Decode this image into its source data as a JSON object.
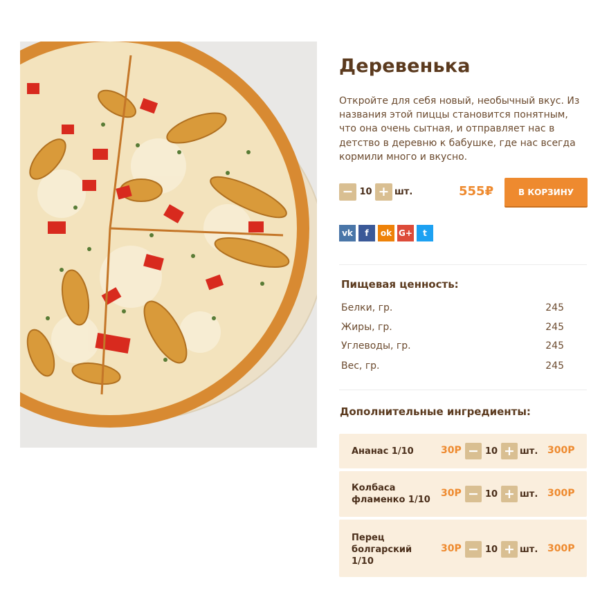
{
  "product": {
    "title": "Деревенька",
    "description": "Откройте для себя новый, необычный вкус. Из названия этой пиццы становится понятным, что она очень сытная, и отправляет нас в детство в деревню к бабушке, где нас всегда кормили много и вкусно.",
    "quantity": "10",
    "unit": "шт.",
    "price": "555₽",
    "add_to_cart_label": "В КОРЗИНУ",
    "minus_symbol": "−",
    "plus_symbol": "+"
  },
  "social": [
    {
      "icon": "vk-icon",
      "glyph": "vk"
    },
    {
      "icon": "facebook-icon",
      "glyph": "f"
    },
    {
      "icon": "odnoklassniki-icon",
      "glyph": "ok"
    },
    {
      "icon": "google-plus-icon",
      "glyph": "G+"
    },
    {
      "icon": "twitter-icon",
      "glyph": "t"
    }
  ],
  "nutrition": {
    "title": "Пищевая ценность:",
    "rows": [
      {
        "label": "Белки, гр.",
        "value": "245"
      },
      {
        "label": "Жиры, гр.",
        "value": "245"
      },
      {
        "label": "Углеводы, гр.",
        "value": "245"
      },
      {
        "label": "Вес, гр.",
        "value": "245"
      }
    ]
  },
  "extras": {
    "title": "Дополнительные ингредиенты:",
    "items": [
      {
        "name": "Ананас 1/10",
        "price": "30Р",
        "quantity": "10",
        "unit": "шт.",
        "total": "300Р"
      },
      {
        "name": "Колбаса фламенко 1/10",
        "price": "30Р",
        "quantity": "10",
        "unit": "шт.",
        "total": "300Р"
      },
      {
        "name": "Перец болгарский 1/10",
        "price": "30Р",
        "quantity": "10",
        "unit": "шт.",
        "total": "300Р"
      }
    ]
  },
  "colors": {
    "accent": "#ee8a2f",
    "heading": "#5b3a1e",
    "qty_button": "#d9bf92",
    "card_bg": "#faeedd"
  }
}
